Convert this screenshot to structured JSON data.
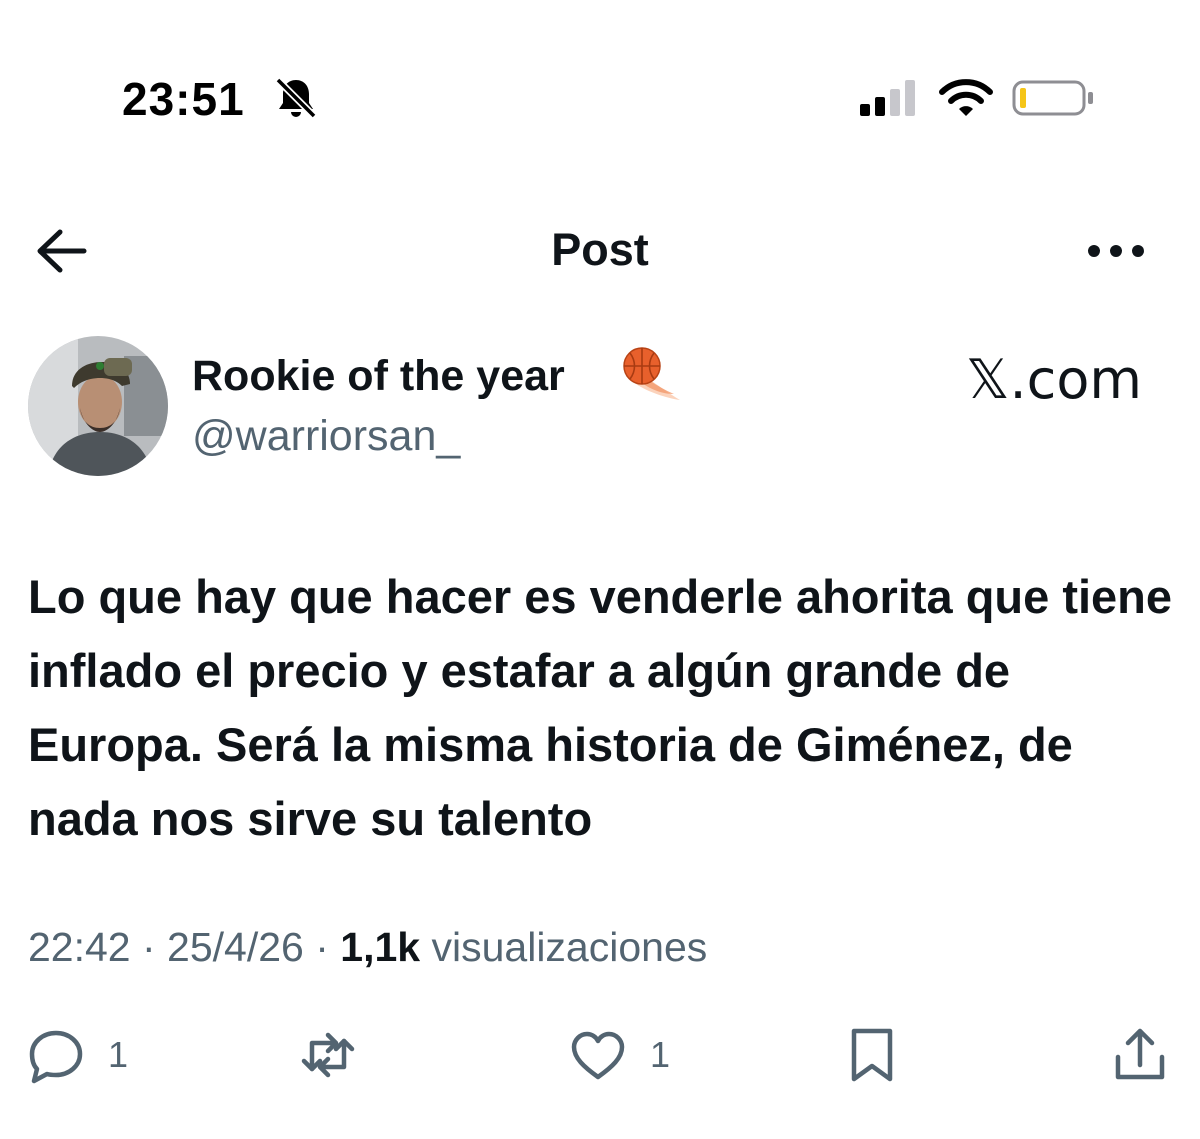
{
  "status_bar": {
    "time": "23:51",
    "icons": [
      "bell-off-icon",
      "signal-icon",
      "wifi-icon",
      "battery-icon"
    ]
  },
  "header": {
    "title": "Post",
    "back_icon": "arrow-left-icon",
    "more_icon": "more-horizontal-icon"
  },
  "author": {
    "display_name": "Rookie of the year",
    "badge_icon": "fire-basketball-emoji",
    "handle": "@warriorsan_"
  },
  "watermark": "𝕏.com",
  "tweet": {
    "text": "Lo que hay que hacer es venderle ahorita que tiene inflado el precio y estafar a algún grande de Europa. Será la misma historia de Giménez, de nada nos sirve su talento",
    "time": "22:42",
    "date": "25/4/26",
    "views_count": "1,1k",
    "views_label": "visualizaciones",
    "separator": " · "
  },
  "actions": {
    "reply_count": "1",
    "repost_count": "",
    "like_count": "1"
  },
  "colors": {
    "text_primary": "#0f1419",
    "text_secondary": "#536471",
    "background": "#ffffff"
  }
}
